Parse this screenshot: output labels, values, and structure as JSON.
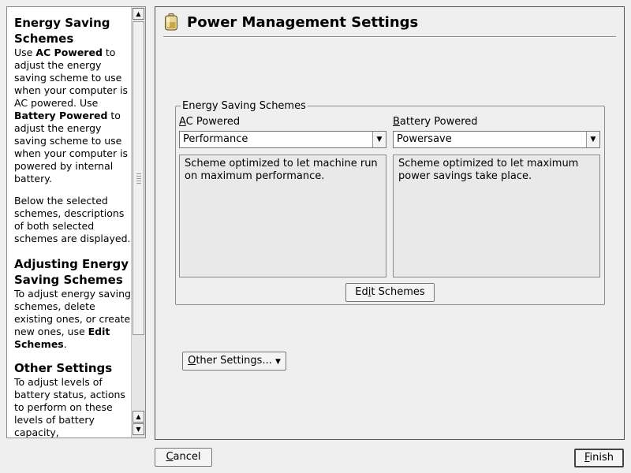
{
  "help": {
    "section1_title": "Energy Saving Schemes",
    "section1_p1": [
      {
        "t": "Use ",
        "b": false
      },
      {
        "t": "AC Powered",
        "b": true
      },
      {
        "t": " to adjust the energy saving scheme to use when your computer is AC powered. Use ",
        "b": false
      },
      {
        "t": "Battery Powered",
        "b": true
      },
      {
        "t": " to adjust the energy saving scheme to use when your computer is powered by internal battery.",
        "b": false
      }
    ],
    "section1_p2": "Below the selected schemes, descriptions of both selected schemes are displayed.",
    "section2_title": "Adjusting Energy Saving Schemes",
    "section2_p1": [
      {
        "t": "To adjust energy saving schemes, delete existing ones, or create new ones, use ",
        "b": false
      },
      {
        "t": "Edit Schemes",
        "b": true
      },
      {
        "t": ".",
        "b": false
      }
    ],
    "section3_title": "Other Settings",
    "section3_p1": "To adjust levels of battery status, actions to perform on these levels of battery capacity,"
  },
  "main": {
    "title": "Power Management Settings",
    "group_title": "Energy Saving Schemes",
    "ac": {
      "label_mnemonic": "A",
      "label_rest": "C Powered",
      "selected": "Performance",
      "description": "Scheme optimized to let machine run on maximum performance."
    },
    "battery": {
      "label_mnemonic": "B",
      "label_rest": "attery Powered",
      "selected": "Powersave",
      "description": "Scheme optimized to let maximum power savings take place."
    },
    "edit_schemes": {
      "before": "Ed",
      "mnemonic": "i",
      "after": "t Schemes"
    },
    "other_settings": {
      "mnemonic": "O",
      "rest": "ther Settings..."
    }
  },
  "footer": {
    "cancel": {
      "mnemonic": "C",
      "rest": "ancel"
    },
    "finish": {
      "mnemonic": "F",
      "rest": "inish"
    }
  },
  "icons": {
    "title_icon": "battery-icon",
    "scroll_up": "arrow-up-icon",
    "scroll_down": "arrow-down-icon",
    "combo_arrow": "chevron-down-icon",
    "menu_arrow": "triangle-down-icon"
  }
}
